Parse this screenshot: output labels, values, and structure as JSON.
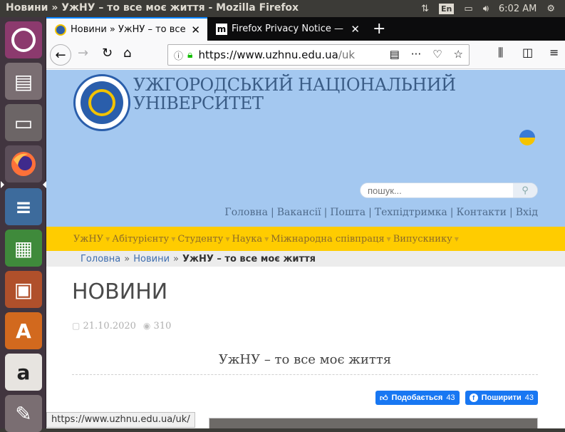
{
  "system": {
    "window_title": "Новини » УжНУ – то все моє життя - Mozilla Firefox",
    "keyboard_layout": "En",
    "clock": "6:02 AM"
  },
  "launcher": {
    "items": [
      {
        "name": "ubuntu-dash"
      },
      {
        "name": "disk-installer"
      },
      {
        "name": "files"
      },
      {
        "name": "firefox"
      },
      {
        "name": "libreoffice-writer"
      },
      {
        "name": "libreoffice-calc"
      },
      {
        "name": "libreoffice-impress"
      },
      {
        "name": "ubuntu-software",
        "glyph": "A"
      },
      {
        "name": "amazon",
        "glyph": "a"
      },
      {
        "name": "system-settings"
      }
    ]
  },
  "tabs": [
    {
      "title": "Новини » УжНУ – то все",
      "active": true
    },
    {
      "title": "Firefox Privacy Notice —",
      "active": false
    }
  ],
  "navbar": {
    "url_host": "https://www.uzhnu.edu.ua",
    "url_path": "/uk/"
  },
  "site": {
    "name_line1": "УЖГОРОДСЬКИЙ НАЦІОНАЛЬНИЙ",
    "name_line2": "УНІВЕРСИТЕТ",
    "search_placeholder": "пошук...",
    "top_links": [
      "Головна",
      "Вакансії",
      "Пошта",
      "Техпідтримка",
      "Контакти",
      "Вхід"
    ],
    "menu": [
      "УжНУ",
      "Абітурієнту",
      "Студенту",
      "Наука",
      "Міжнародна співпраця",
      "Випускнику"
    ],
    "breadcrumb": {
      "home": "Головна",
      "section": "Новини",
      "current": "УжНУ – то все моє життя"
    },
    "heading": "НОВИНИ",
    "date": "21.10.2020",
    "views": "310",
    "article_title": "УжНУ – то все моє життя",
    "like_label": "Подобається",
    "like_count": "43",
    "share_label": "Поширити",
    "share_count": "43"
  },
  "status_bar_url": "https://www.uzhnu.edu.ua/uk/",
  "colors": {
    "hero_bg": "#a4c8f0",
    "menu_bg": "#ffcc00",
    "facebook": "#1877f2",
    "firefox_accent": "#0a84ff"
  }
}
